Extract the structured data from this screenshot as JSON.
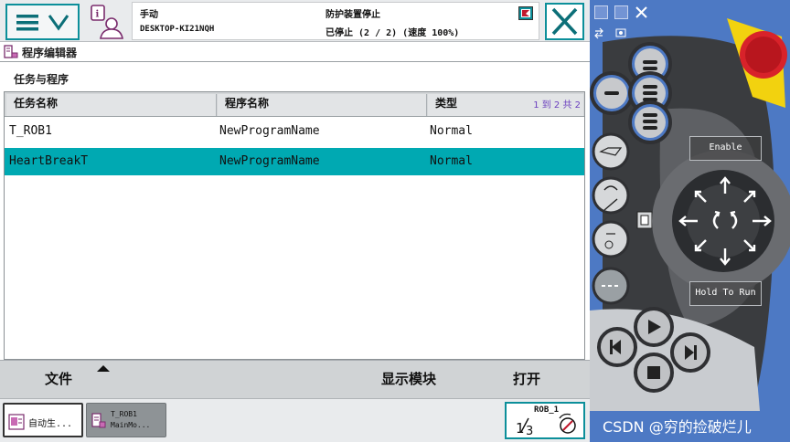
{
  "status": {
    "mode": "手动",
    "controller": "DESKTOP-KI21NQH",
    "state": "防护装置停止",
    "run_state": "已停止 (2 / 2) (速度 100%)"
  },
  "window_title": "程序编辑器",
  "section_label": "任务与程序",
  "table": {
    "columns": [
      "任务名称",
      "程序名称",
      "类型"
    ],
    "pager": "1 到 2 共 2",
    "rows": [
      {
        "task": "T_ROB1",
        "program": "NewProgramName",
        "type": "Normal",
        "selected": false
      },
      {
        "task": "HeartBreakT",
        "program": "NewProgramName",
        "type": "Normal",
        "selected": true
      }
    ]
  },
  "commands": {
    "file": "文件",
    "show_module": "显示模块",
    "open": "打开"
  },
  "taskbar": {
    "task1": "自动生...",
    "task2_line1": "T_ROB1",
    "task2_line2": "MainMo...",
    "robot": "ROB_1",
    "fraction": "1/3"
  },
  "pendant": {
    "enable_label": "Enable",
    "hold_label": "Hold To Run"
  },
  "watermark": "CSDN @穷的捡破烂儿",
  "colors": {
    "accent": "#0c8f9a",
    "selection": "#00a9b2",
    "pendant_blue": "#4d79c4",
    "estop_red": "#d8222a",
    "estop_yellow": "#f2d20f"
  }
}
